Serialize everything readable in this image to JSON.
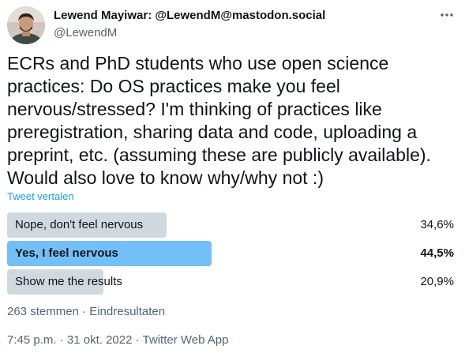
{
  "author": {
    "display_name": "Lewend Mayiwar: @LewendM@mastodon.social",
    "handle": "@LewendM"
  },
  "tweet": {
    "text": "ECRs and PhD students who use open science practices: Do OS practices make you feel\nnervous/stressed? I'm thinking of practices like\npreregistration, sharing data and code, uploading a\npreprint, etc. (assuming these are publicly available).\nWould also love to know why/why not :)",
    "translate_label": "Tweet vertalen"
  },
  "poll": {
    "options": [
      {
        "label": "Nope, don't feel nervous",
        "percent_text": "34,6%",
        "percent": 34.6,
        "winner": false
      },
      {
        "label": "Yes, I feel nervous",
        "percent_text": "44,5%",
        "percent": 44.5,
        "winner": true
      },
      {
        "label": "Show me the results",
        "percent_text": "20,9%",
        "percent": 20.9,
        "winner": false
      }
    ],
    "meta": "263 stemmen · Eindresultaten",
    "bar_color": "#cfd9de",
    "winner_color": "#73c0f8"
  },
  "footer": {
    "time": "7:45 p.m.",
    "separator1": " · ",
    "date": "31 okt. 2022",
    "separator2": " · ",
    "source": "Twitter Web App"
  },
  "icons": {
    "more": "more-horizontal-icon",
    "avatar": "avatar-photo"
  }
}
